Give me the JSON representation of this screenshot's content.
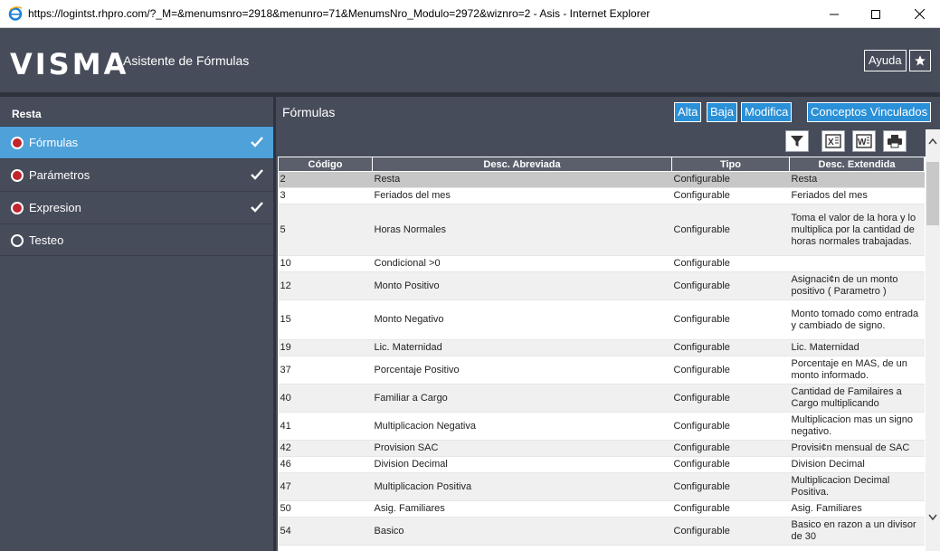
{
  "window": {
    "title": "https://logintst.rhpro.com/?_M=&menumsnro=2918&menunro=71&MenumsNro_Modulo=2972&wiznro=2 - Asis - Internet Explorer"
  },
  "header": {
    "logo": "VISMA",
    "app_title": "Asistente de Fórmulas",
    "help_label": "Ayuda",
    "star_icon": "star-icon"
  },
  "sidebar": {
    "heading": "Resta",
    "items": [
      {
        "label": "Fórmulas",
        "active": true,
        "checked": true,
        "status": "red"
      },
      {
        "label": "Parámetros",
        "active": false,
        "checked": true,
        "status": "red"
      },
      {
        "label": "Expresion",
        "active": false,
        "checked": true,
        "status": "red"
      },
      {
        "label": "Testeo",
        "active": false,
        "checked": false,
        "status": "empty"
      }
    ]
  },
  "main": {
    "section_title": "Fórmulas",
    "actions": {
      "alta": "Alta",
      "baja": "Baja",
      "modifica": "Modifica",
      "conceptos": "Conceptos Vinculados"
    },
    "tools": [
      "filter-icon",
      "excel-icon",
      "word-icon",
      "print-icon"
    ],
    "columns": [
      "Código",
      "Desc. Abreviada",
      "Tipo",
      "Desc. Extendida"
    ],
    "rows": [
      [
        "2",
        "Resta",
        "Configurable",
        "Resta"
      ],
      [
        "3",
        "Feriados del mes",
        "Configurable",
        "Feriados del mes"
      ],
      [
        "5",
        "Horas Normales",
        "Configurable",
        "Toma el valor de la hora y lo multiplica por la cantidad de horas normales trabajadas."
      ],
      [
        "10",
        "Condicional >0",
        "Configurable",
        ""
      ],
      [
        "12",
        "Monto Positivo",
        "Configurable",
        "Asignaci¢n de un monto positivo ( Parametro )"
      ],
      [
        "15",
        "Monto Negativo",
        "Configurable",
        "Monto tomado como entrada y cambiado de signo."
      ],
      [
        "19",
        "Lic. Maternidad",
        "Configurable",
        "Lic. Maternidad"
      ],
      [
        "37",
        "Porcentaje Positivo",
        "Configurable",
        "Porcentaje en MAS, de un monto informado."
      ],
      [
        "40",
        "Familiar a Cargo",
        "Configurable",
        "Cantidad de Familaires a Cargo multiplicando"
      ],
      [
        "41",
        "Multiplicacion Negativa",
        "Configurable",
        "Multiplicacion mas un signo negativo."
      ],
      [
        "42",
        "Provision SAC",
        "Configurable",
        "Provisi¢n mensual de SAC"
      ],
      [
        "46",
        "Division Decimal",
        "Configurable",
        "Division Decimal"
      ],
      [
        "47",
        "Multiplicacion Positiva",
        "Configurable",
        "Multiplicacion Decimal Positiva."
      ],
      [
        "50",
        "Asig. Familiares",
        "Configurable",
        "Asig. Familiares"
      ],
      [
        "54",
        "Basico",
        "Configurable",
        "Basico en razon a un divisor de 30"
      ]
    ]
  },
  "colors": {
    "header_bg": "#474c5a",
    "active_blue": "#4ea1d9",
    "button_blue": "#2a90d8",
    "status_red": "#c0262c"
  }
}
